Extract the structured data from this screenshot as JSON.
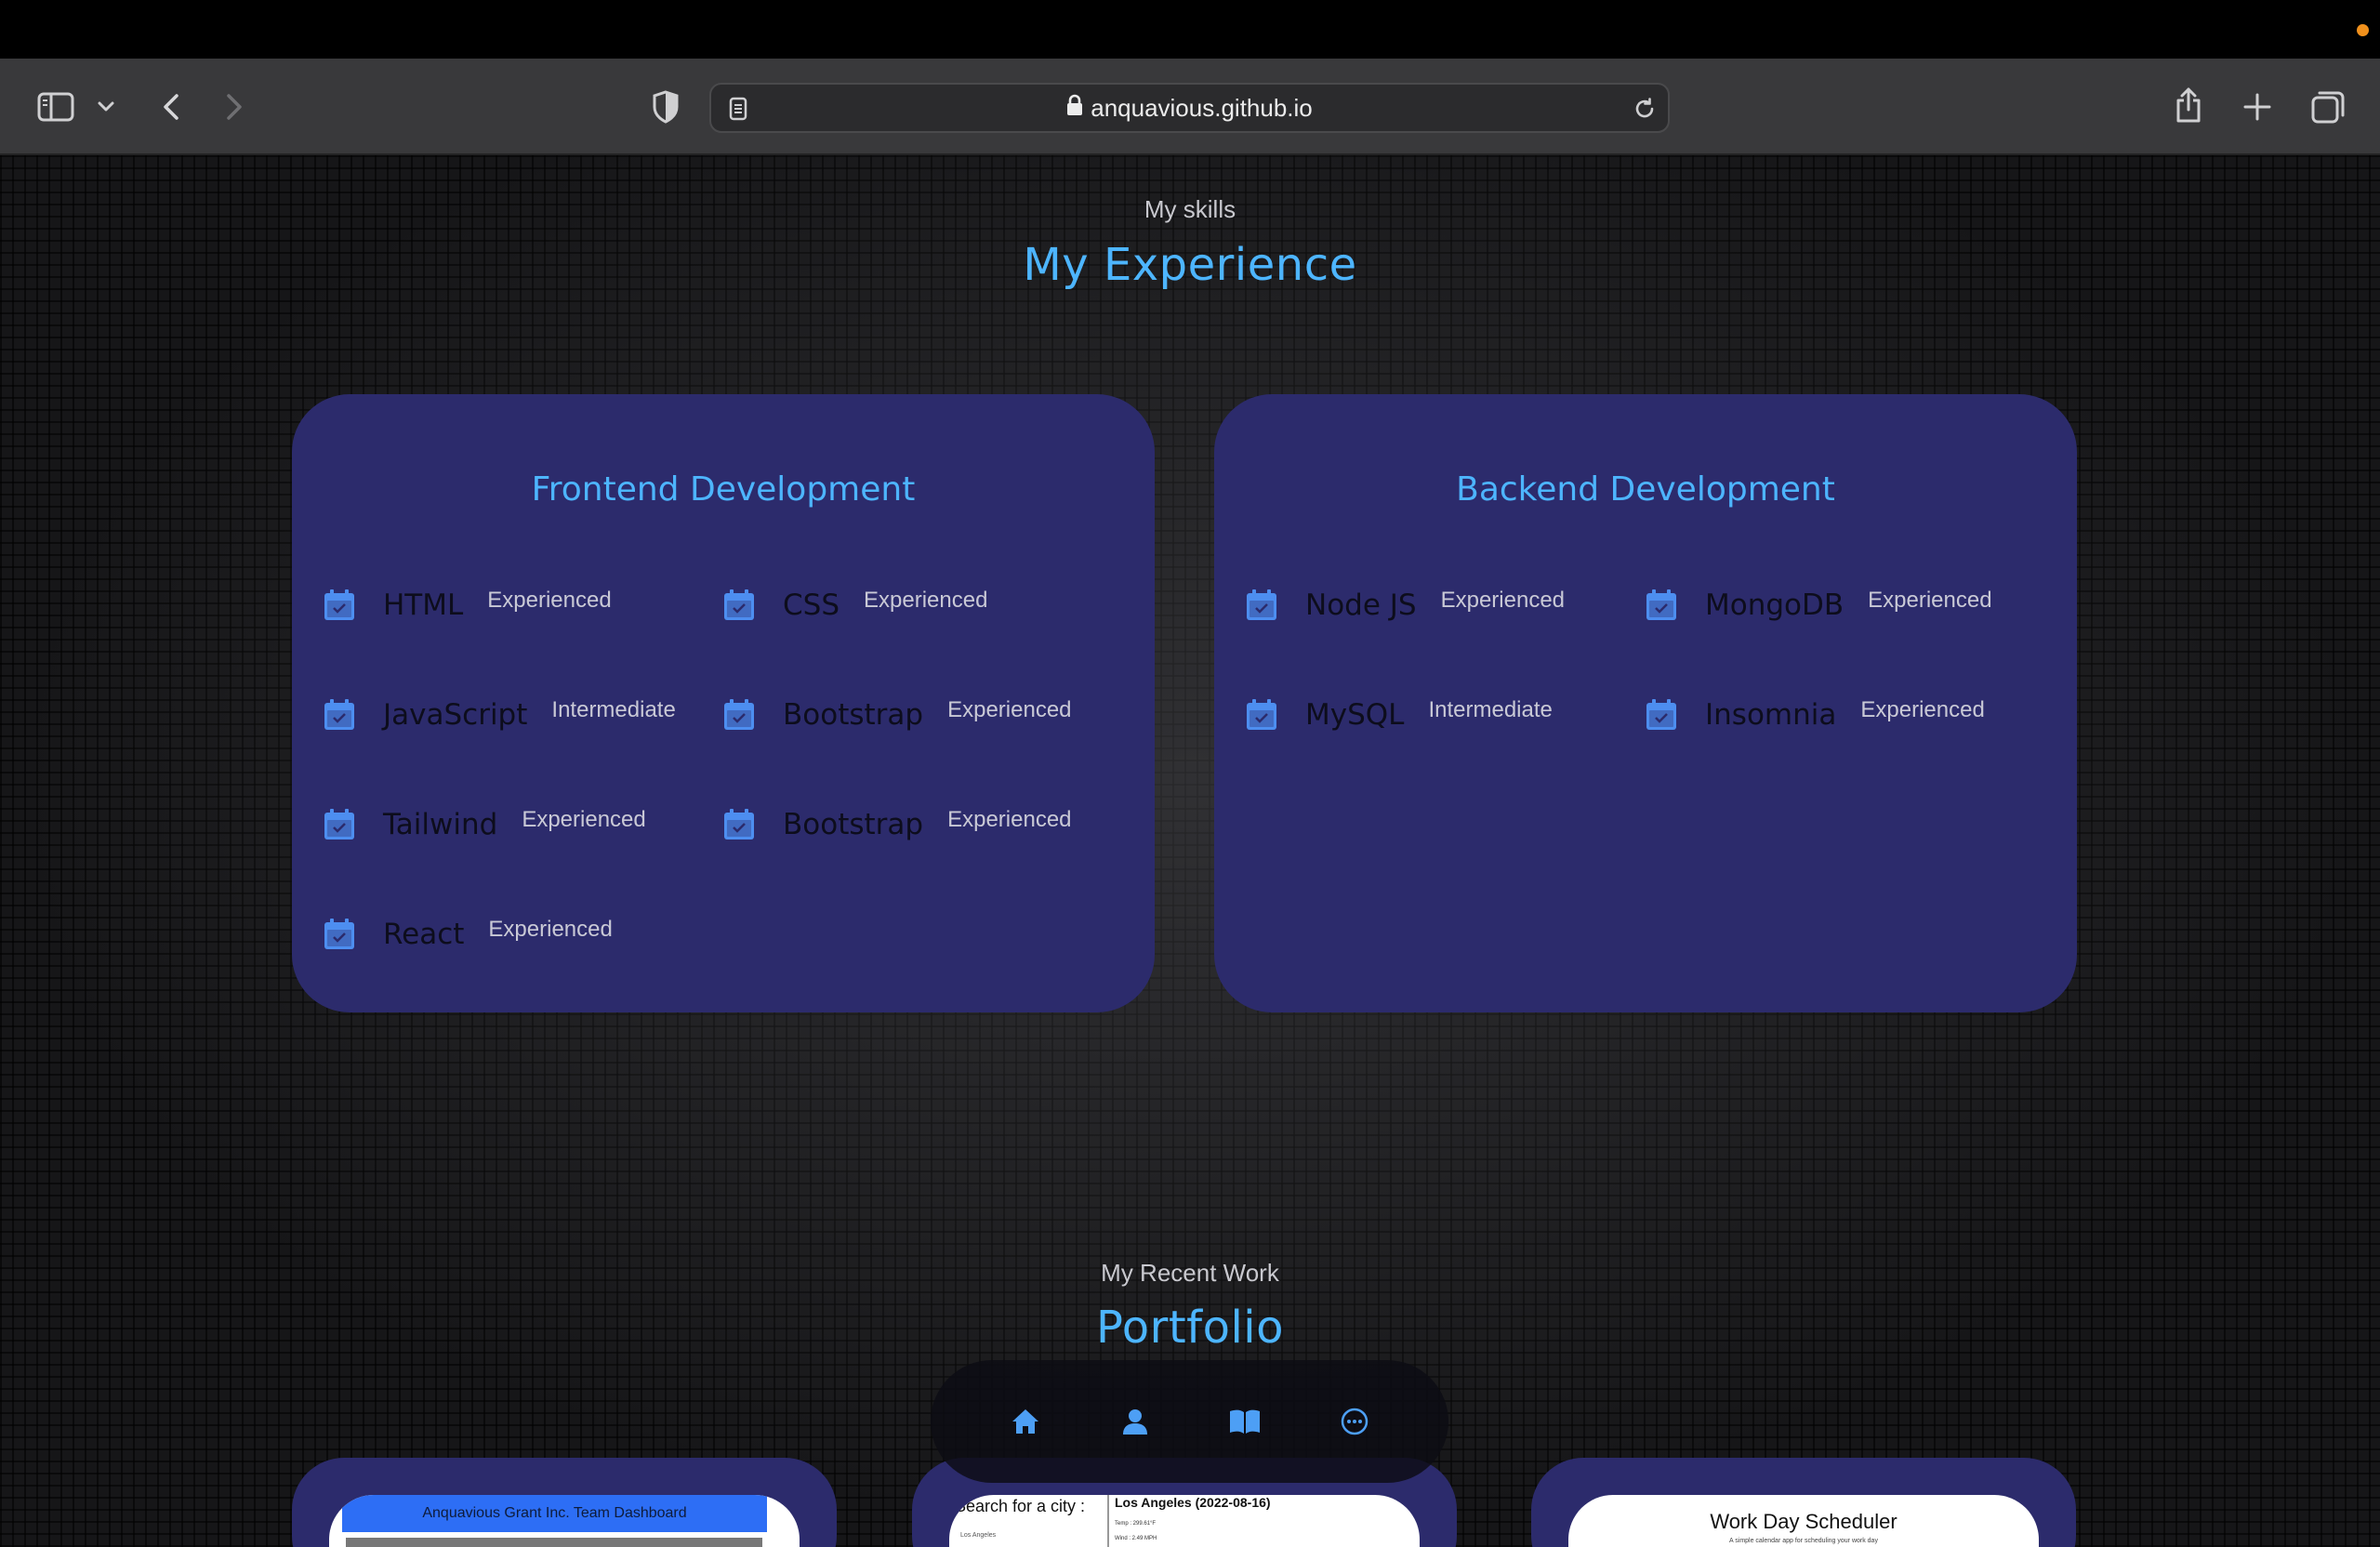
{
  "browser": {
    "url": "anquavious.github.io",
    "icons": [
      "sidebar-icon",
      "chevron-down-icon",
      "back-icon",
      "forward-icon",
      "privacy-shield-icon",
      "reader-icon",
      "lock-icon",
      "reload-icon",
      "share-icon",
      "new-tab-icon",
      "tab-overview-icon"
    ]
  },
  "experience": {
    "subtitle": "My skills",
    "title": "My Experience",
    "frontend": {
      "title": "Frontend Development",
      "skills": [
        {
          "name": "HTML",
          "level": "Experienced"
        },
        {
          "name": "CSS",
          "level": "Experienced"
        },
        {
          "name": "JavaScript",
          "level": "Intermediate"
        },
        {
          "name": "Bootstrap",
          "level": "Experienced"
        },
        {
          "name": "Tailwind",
          "level": "Experienced"
        },
        {
          "name": "Bootstrap",
          "level": "Experienced"
        },
        {
          "name": "React",
          "level": "Experienced"
        }
      ]
    },
    "backend": {
      "title": "Backend Development",
      "skills": [
        {
          "name": "Node JS",
          "level": "Experienced"
        },
        {
          "name": "MongoDB",
          "level": "Experienced"
        },
        {
          "name": "MySQL",
          "level": "Intermediate"
        },
        {
          "name": "Insomnia",
          "level": "Experienced"
        }
      ]
    }
  },
  "portfolio": {
    "subtitle": "My Recent Work",
    "title": "Portfolio",
    "projects": [
      {
        "header": "Anquavious Grant Inc. Team Dashboard"
      },
      {
        "left_label": "Search for a city :",
        "input_value": "Los Angeles",
        "right_title": "Los Angeles (2022-08-16)",
        "line1": "Temp : 299.61°F",
        "line2": "Wind : 2.49 MPH"
      },
      {
        "title": "Work Day Scheduler",
        "subtitle": "A simple calendar app for scheduling your work day"
      }
    ]
  },
  "nav": {
    "items": [
      "home-icon",
      "user-icon",
      "book-icon",
      "chat-icon"
    ]
  },
  "colors": {
    "accent": "#4db5ff",
    "card": "#2c2b6c",
    "icon_blue": "#4d8ef0"
  }
}
